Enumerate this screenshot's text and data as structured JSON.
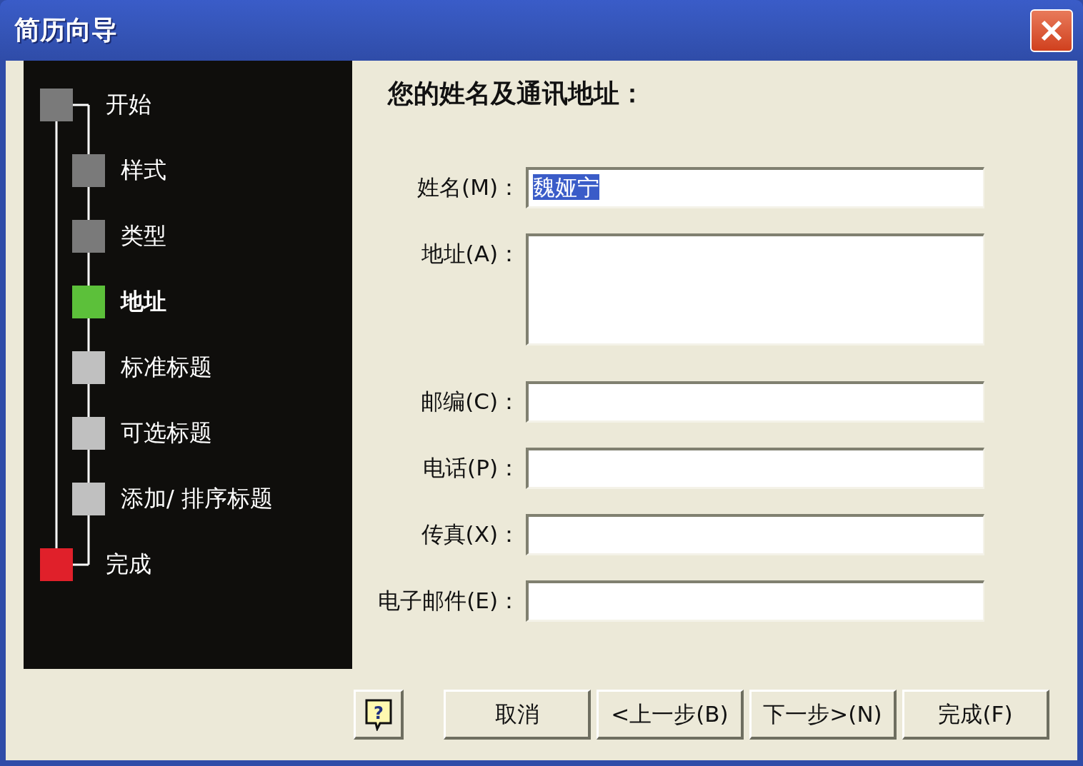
{
  "window": {
    "title": "简历向导"
  },
  "steps": [
    {
      "label": "开始",
      "kind": "endpoint",
      "color": "#7a7a7a",
      "selected": false
    },
    {
      "label": "样式",
      "kind": "step",
      "color": "#7a7a7a",
      "selected": false
    },
    {
      "label": "类型",
      "kind": "step",
      "color": "#7a7a7a",
      "selected": false
    },
    {
      "label": "地址",
      "kind": "step",
      "color": "#5cc03a",
      "selected": true
    },
    {
      "label": "标准标题",
      "kind": "step",
      "color": "#c0c0c0",
      "selected": false
    },
    {
      "label": "可选标题",
      "kind": "step",
      "color": "#c0c0c0",
      "selected": false
    },
    {
      "label": "添加/ 排序标题",
      "kind": "step",
      "color": "#c0c0c0",
      "selected": false
    },
    {
      "label": "完成",
      "kind": "endpoint",
      "color": "#e0202a",
      "selected": false
    }
  ],
  "heading": "您的姓名及通讯地址：",
  "fields": [
    {
      "label": "姓名(M)：",
      "kind": "single",
      "value": "魏娅宁",
      "highlighted": true
    },
    {
      "label": "地址(A)：",
      "kind": "multiline"
    },
    {
      "label": "邮编(C)：",
      "kind": "single"
    },
    {
      "label": "电话(P)：",
      "kind": "single"
    },
    {
      "label": "传真(X)：",
      "kind": "single"
    },
    {
      "label": "电子邮件(E)：",
      "kind": "single"
    }
  ],
  "buttons": [
    {
      "kind": "help",
      "glyph": "?"
    },
    {
      "kind": "text",
      "label": "取消"
    },
    {
      "kind": "text",
      "label": "<上一步(B)"
    },
    {
      "kind": "text",
      "label": "下一步>(N)"
    },
    {
      "kind": "text",
      "label": "完成(F)"
    }
  ]
}
